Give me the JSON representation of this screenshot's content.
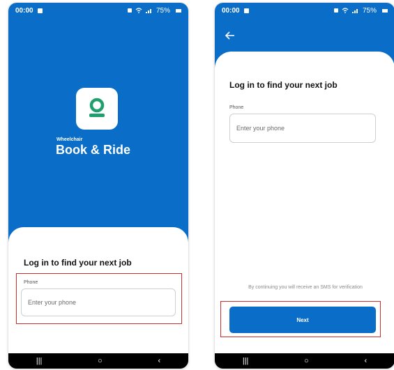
{
  "status_bar": {
    "time": "00:00",
    "battery": "75%"
  },
  "left_screen": {
    "brand_small": "Wheelchair",
    "brand_name": "Book & Ride",
    "title": "Log in to find your next job",
    "phone_label": "Phone",
    "phone_placeholder": "Enter your phone"
  },
  "right_screen": {
    "title": "Log in to find your next job",
    "phone_label": "Phone",
    "phone_placeholder": "Enter your phone",
    "sms_note": "By continuing you will receive an SMS for verification",
    "next_label": "Next"
  },
  "nav": {
    "recents": "|||",
    "home": "○",
    "back": "‹"
  },
  "colors": {
    "brand_blue": "#0a6ec8",
    "brand_green": "#1f9e6e",
    "highlight_red": "#d12a2a"
  },
  "icons": [
    "back-arrow-icon",
    "alarm-icon",
    "wifi-icon",
    "signal-icon",
    "battery-icon",
    "app-logo-icon"
  ]
}
